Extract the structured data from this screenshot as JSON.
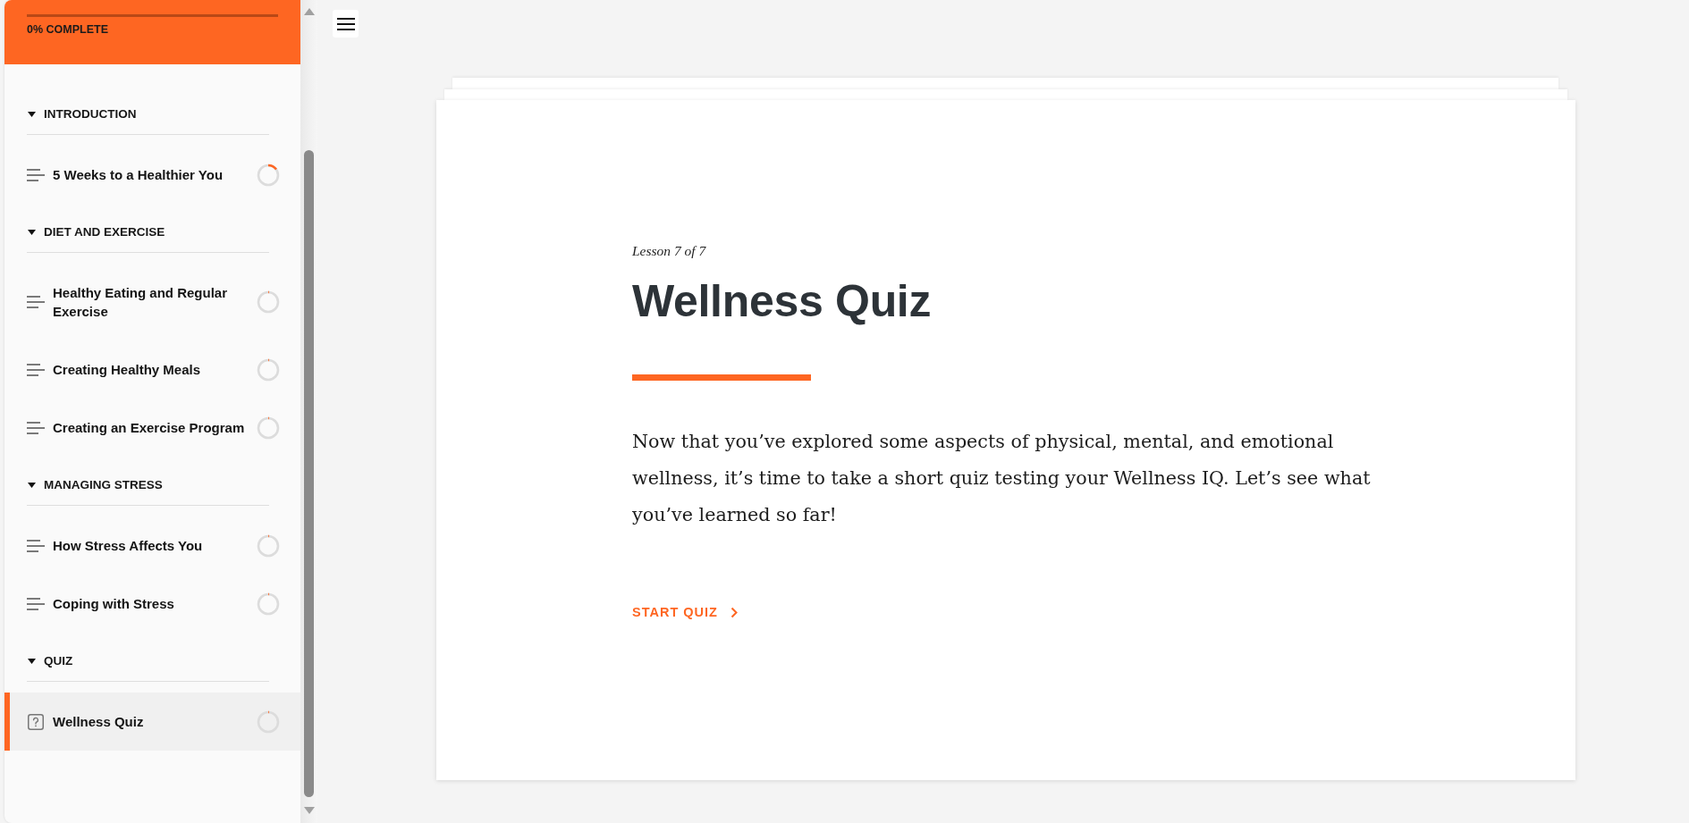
{
  "sidebar": {
    "progress": {
      "level": 0,
      "label": "0% COMPLETE"
    },
    "sections": [
      {
        "title": "INTRODUCTION",
        "expanded": true,
        "lessons": [
          {
            "kind": "text",
            "title": "5 Weeks to a Healthier You",
            "selected": false,
            "started": true
          }
        ]
      },
      {
        "title": "DIET AND EXERCISE",
        "expanded": true,
        "lessons": [
          {
            "kind": "text",
            "title": "Healthy Eating and Regular Exercise",
            "selected": false,
            "started": false
          },
          {
            "kind": "text",
            "title": "Creating Healthy Meals",
            "selected": false,
            "started": false
          },
          {
            "kind": "text",
            "title": "Creating an Exercise Program",
            "selected": false,
            "started": false
          }
        ]
      },
      {
        "title": "MANAGING STRESS",
        "expanded": true,
        "lessons": [
          {
            "kind": "text",
            "title": "How Stress Affects You",
            "selected": false,
            "started": false
          },
          {
            "kind": "text",
            "title": "Coping with Stress",
            "selected": false,
            "started": false
          }
        ]
      },
      {
        "title": "QUIZ",
        "expanded": true,
        "lessons": [
          {
            "kind": "quiz",
            "title": "Wellness Quiz",
            "selected": true,
            "started": false
          }
        ]
      }
    ]
  },
  "lesson": {
    "counter": "Lesson 7 of 7",
    "title": "Wellness Quiz",
    "body": "Now that you’ve explored some aspects of physical, mental, and emotional wellness, it’s time to take a short quiz testing your Wellness IQ. Let’s see what you’ve learned so far!",
    "action": "START QUIZ"
  }
}
